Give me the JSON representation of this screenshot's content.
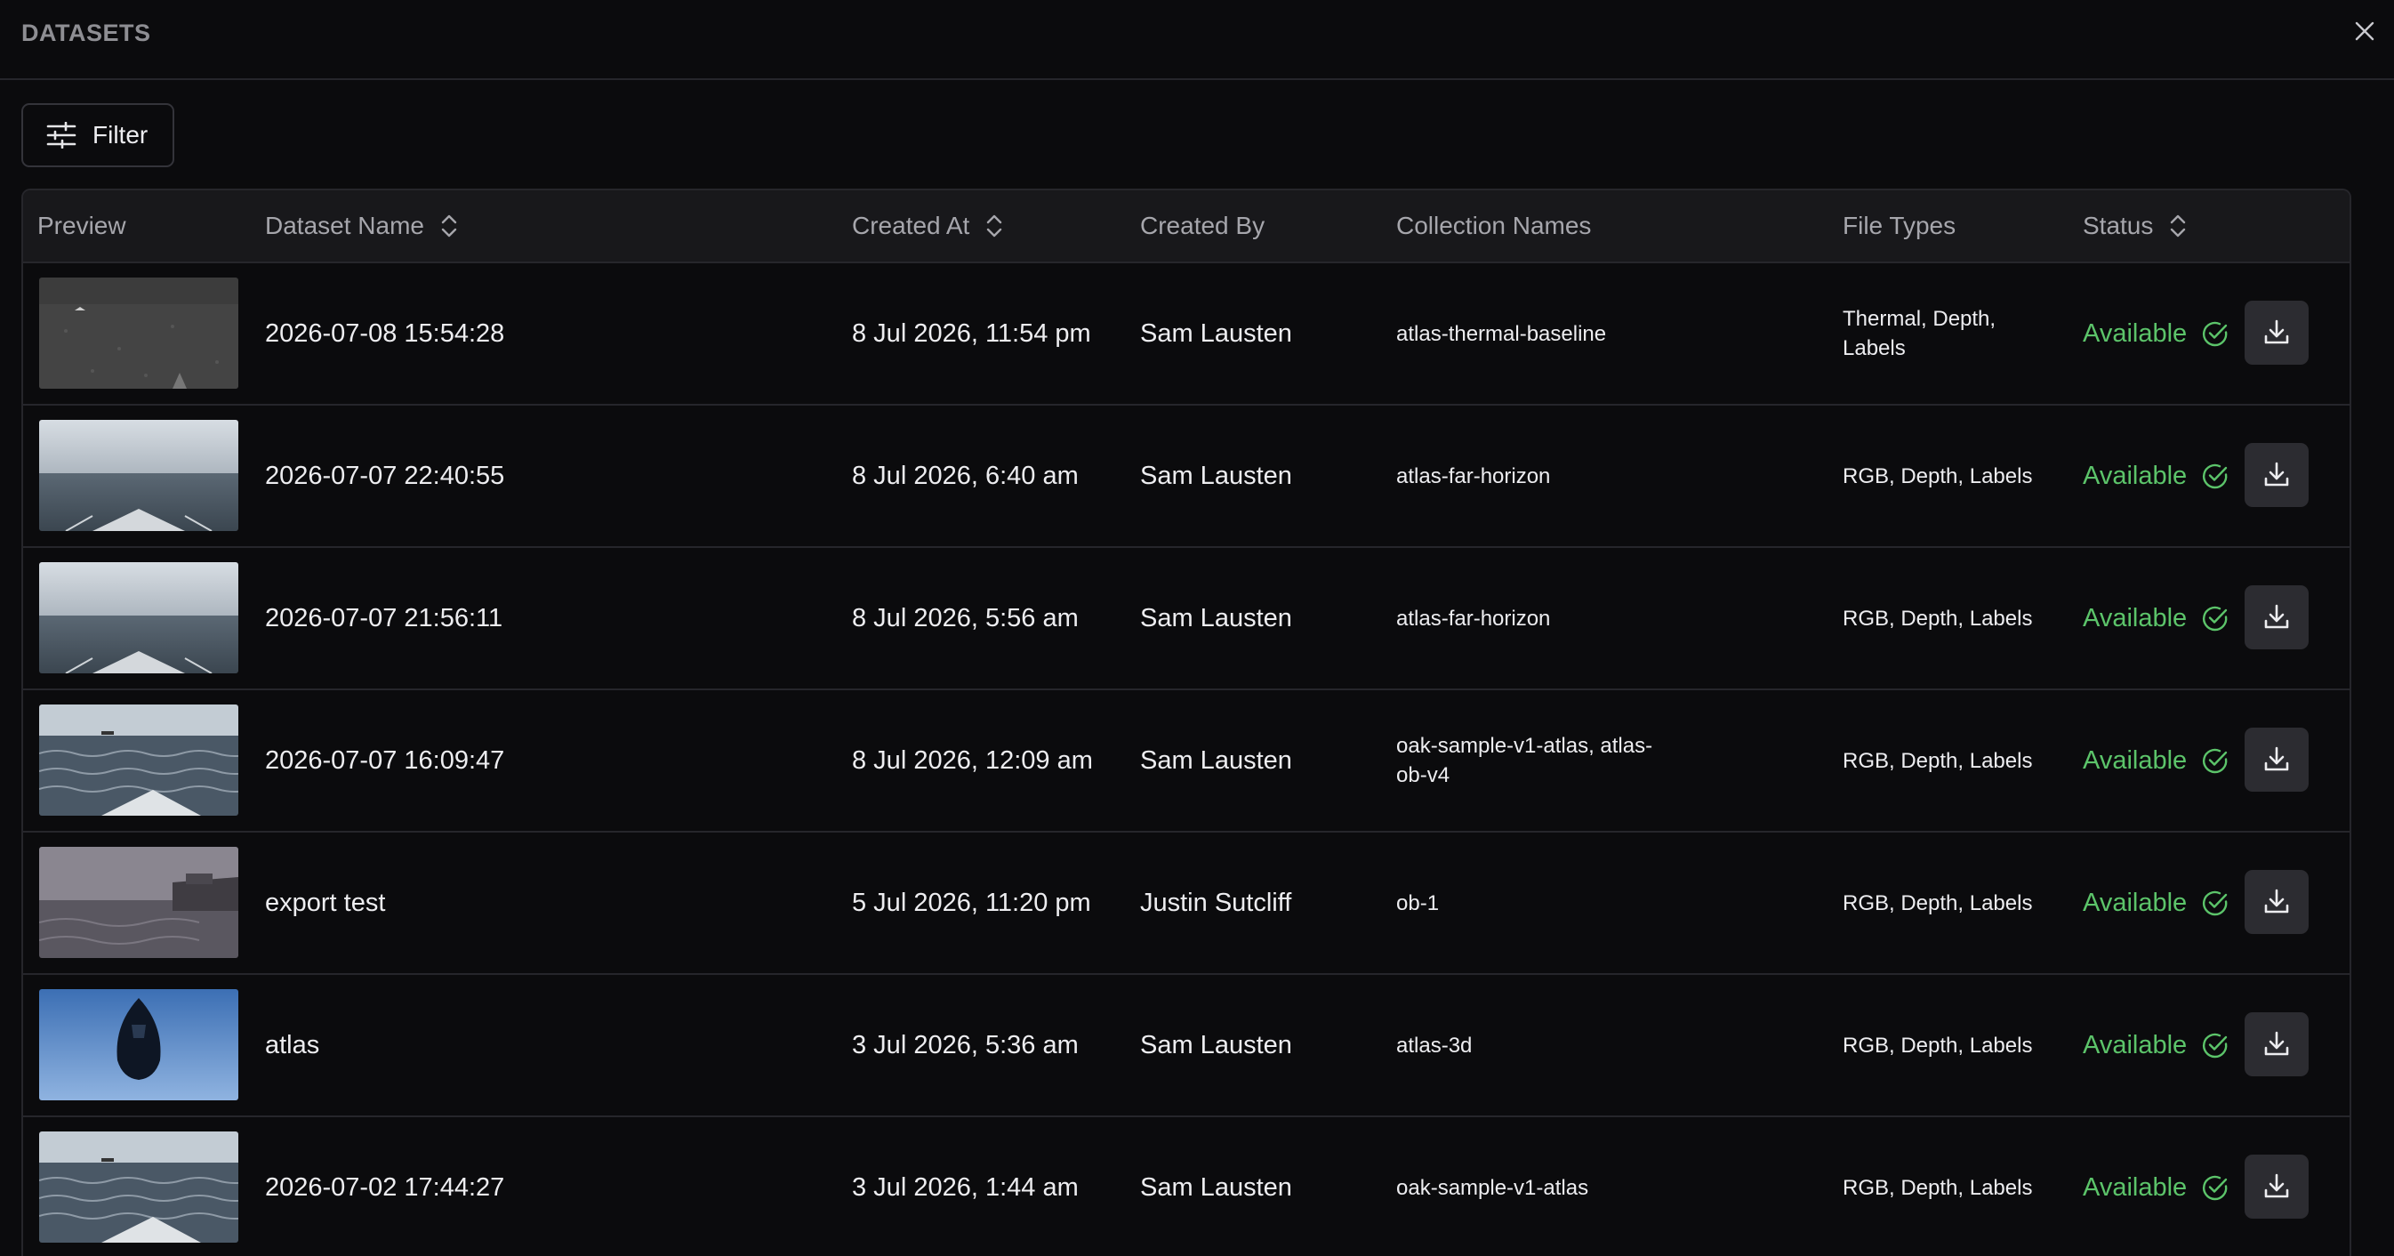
{
  "header": {
    "title": "DATASETS"
  },
  "toolbar": {
    "filter_label": "Filter"
  },
  "table": {
    "columns": {
      "preview": "Preview",
      "dataset_name": "Dataset Name",
      "created_at": "Created At",
      "created_by": "Created By",
      "collection_names": "Collection Names",
      "file_types": "File Types",
      "status": "Status"
    },
    "rows": [
      {
        "name": "2026-07-08 15:54:28",
        "created_at": "8 Jul 2026, 11:54 pm",
        "created_by": "Sam Lausten",
        "collections": "atlas-thermal-baseline",
        "file_types": "Thermal, Depth, Labels",
        "status": "Available",
        "preview": "thermal-sea"
      },
      {
        "name": "2026-07-07 22:40:55",
        "created_at": "8 Jul 2026, 6:40 am",
        "created_by": "Sam Lausten",
        "collections": "atlas-far-horizon",
        "file_types": "RGB, Depth, Labels",
        "status": "Available",
        "preview": "calm-horizon"
      },
      {
        "name": "2026-07-07 21:56:11",
        "created_at": "8 Jul 2026, 5:56 am",
        "created_by": "Sam Lausten",
        "collections": "atlas-far-horizon",
        "file_types": "RGB, Depth, Labels",
        "status": "Available",
        "preview": "calm-horizon"
      },
      {
        "name": "2026-07-07 16:09:47",
        "created_at": "8 Jul 2026, 12:09 am",
        "created_by": "Sam Lausten",
        "collections": "oak-sample-v1-atlas, atlas-ob-v4",
        "file_types": "RGB, Depth, Labels",
        "status": "Available",
        "preview": "rough-sea"
      },
      {
        "name": "export test",
        "created_at": "5 Jul 2026, 11:20 pm",
        "created_by": "Justin Sutcliff",
        "collections": "ob-1",
        "file_types": "RGB, Depth, Labels",
        "status": "Available",
        "preview": "harbor"
      },
      {
        "name": "atlas",
        "created_at": "3 Jul 2026, 5:36 am",
        "created_by": "Sam Lausten",
        "collections": "atlas-3d",
        "file_types": "RGB, Depth, Labels",
        "status": "Available",
        "preview": "boat-model"
      },
      {
        "name": "2026-07-02 17:44:27",
        "created_at": "3 Jul 2026, 1:44 am",
        "created_by": "Sam Lausten",
        "collections": "oak-sample-v1-atlas",
        "file_types": "RGB, Depth, Labels",
        "status": "Available",
        "preview": "rough-sea"
      }
    ]
  },
  "icons": {
    "close": "close-icon",
    "filter": "sliders-icon",
    "sort": "chevron-up-down-icon",
    "status": "check-circle-icon",
    "download": "download-icon"
  },
  "colors": {
    "background": "#0b0b0d",
    "header_row": "#18181b",
    "status_available": "#5cc46a",
    "button_bg": "#2c2c31"
  }
}
